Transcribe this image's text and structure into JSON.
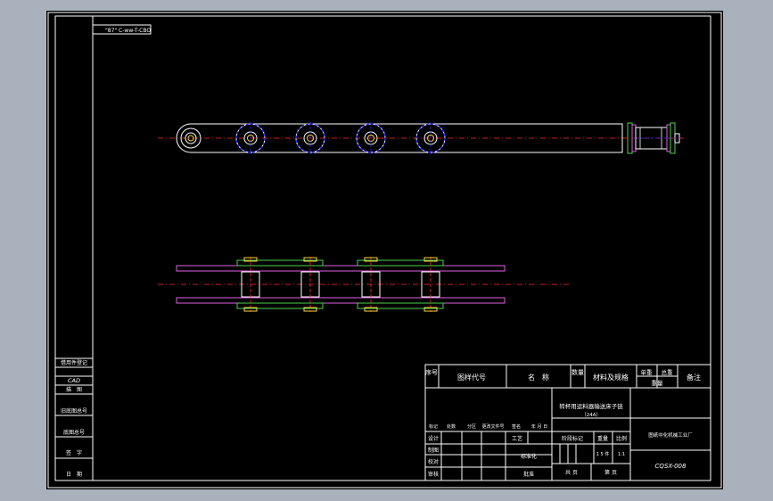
{
  "drawing": {
    "id_box": "\"87\" C-ww-T-CBO",
    "title_block": {
      "header": {
        "seq": "序号",
        "code": "图样代号",
        "name": "名　称",
        "qty": "数量",
        "material": "材料及规格",
        "unit_weight": "单重",
        "total_weight": "总重",
        "weight": "重量",
        "remark": "备注"
      },
      "product_name": "转杯用运料器输送床子链",
      "product_sub": "（24A）",
      "company": "图纸中化机械工业厂",
      "drawing_number": "CQSX-008",
      "revision_row": [
        "标记",
        "处数",
        "分区",
        "更改文件号",
        "签名",
        "年 月 日"
      ],
      "sign_rows": [
        "设计",
        "制图",
        "校对",
        "审核"
      ],
      "mid_labels": [
        "工艺",
        "标准化",
        "批准"
      ],
      "stage_label": "阶段标记",
      "weight_label": "重量",
      "scale_label": "比例",
      "sheet_count": "1 5 件",
      "scale": "1:1",
      "total_sheets": "共 页",
      "sheet_no": "第 页"
    },
    "side_column": [
      "借用件登记",
      "CAD",
      "描　图",
      "旧底图总号",
      "底图总号",
      "签　字",
      "日　期"
    ]
  },
  "colors": {
    "background": "#000000",
    "frame": "#ffffff",
    "center_line": "#ff2a2a",
    "hole_blue": "#2b2bff",
    "pin_yellow": "#ffd23c",
    "plate_magenta": "#e060e0",
    "plate_green": "#4cd34c",
    "roller_white": "#e8e8e8",
    "outside": "#a9b2bc"
  }
}
